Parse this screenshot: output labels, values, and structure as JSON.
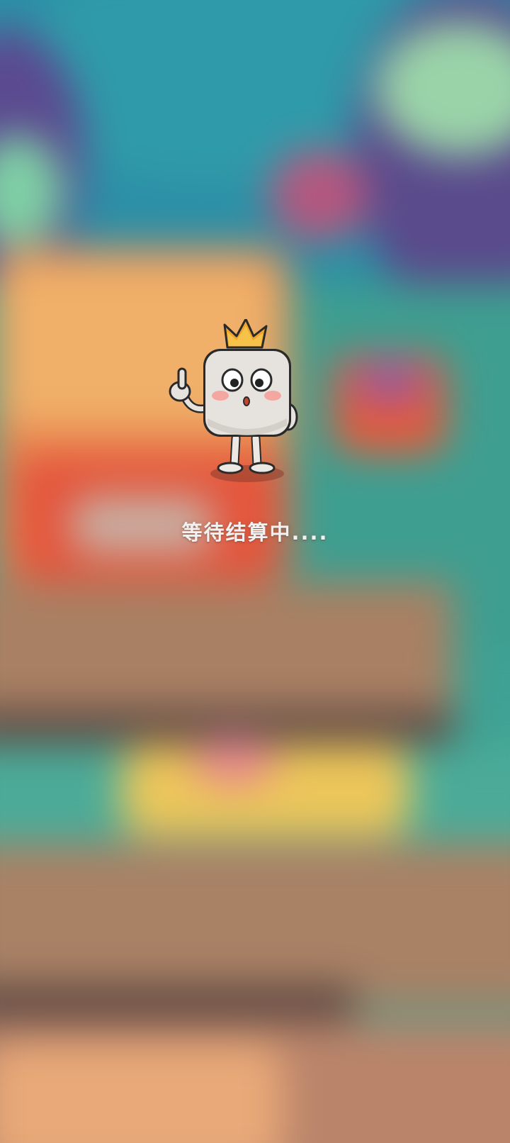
{
  "status": {
    "loading_text": "等待结算中...."
  },
  "mascot": {
    "icon": "crowned-tofu-mascot-icon"
  },
  "colors": {
    "background_teal": "#3fa294",
    "crown": "#f0a52c",
    "body": "#e6e3df",
    "cheek": "#f3a7a0",
    "text": "#f1f1f1"
  }
}
